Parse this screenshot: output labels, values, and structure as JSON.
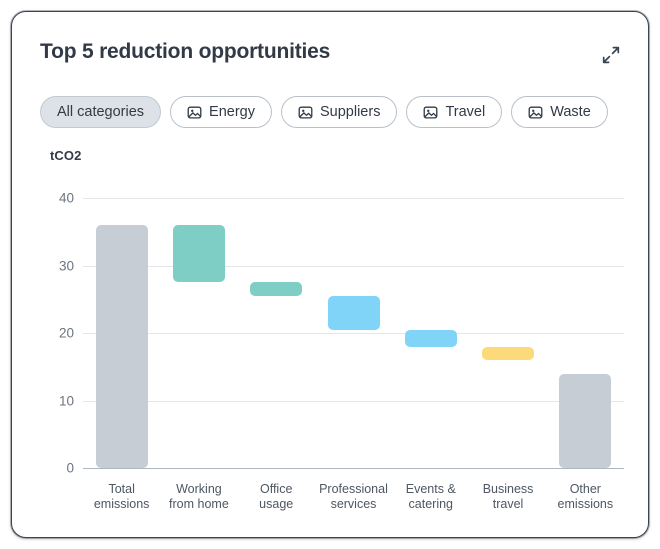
{
  "card": {
    "title": "Top 5 reduction opportunities",
    "expand_icon": "expand-arrows-icon"
  },
  "filters": {
    "chips": [
      {
        "label": "All categories",
        "active": true,
        "icon": null
      },
      {
        "label": "Energy",
        "active": false,
        "icon": "image-placeholder-icon"
      },
      {
        "label": "Suppliers",
        "active": false,
        "icon": "image-placeholder-icon"
      },
      {
        "label": "Travel",
        "active": false,
        "icon": "image-placeholder-icon"
      },
      {
        "label": "Waste",
        "active": false,
        "icon": "image-placeholder-icon"
      }
    ]
  },
  "colors": {
    "gray": "#c6cdd4",
    "teal": "#7ecec6",
    "blue": "#80d4f8",
    "yellow": "#fcd979",
    "grid": "#e3e7eb",
    "axis": "#aeb6bf",
    "text": "#313a46",
    "chip_active_bg": "#dde2e8"
  },
  "chart_data": {
    "type": "bar",
    "subtype": "waterfall",
    "title": "Top 5 reduction opportunities",
    "xlabel": "",
    "ylabel": "tCO2",
    "ylim": [
      0,
      40
    ],
    "yticks": [
      0,
      10,
      20,
      30,
      40
    ],
    "ytick_labels": [
      "0",
      "10",
      "20",
      "30",
      "40"
    ],
    "grid": true,
    "legend": false,
    "categories": [
      "Total emissions",
      "Working from home",
      "Office usage",
      "Professional services",
      "Events & catering",
      "Business travel",
      "Other emissions"
    ],
    "bars": [
      {
        "category": "Total emissions",
        "label_line1": "Total",
        "label_line2": "emissions",
        "base": 0,
        "top": 36,
        "value": 36,
        "kind": "total",
        "color": "#c6cdd4"
      },
      {
        "category": "Working from home",
        "label_line1": "Working",
        "label_line2": "from home",
        "base": 27.5,
        "top": 36,
        "value": -8.5,
        "kind": "decrease",
        "color": "#7ecec6"
      },
      {
        "category": "Office usage",
        "label_line1": "Office",
        "label_line2": "usage",
        "base": 25.5,
        "top": 27.5,
        "value": -2,
        "kind": "decrease",
        "color": "#7ecec6"
      },
      {
        "category": "Professional services",
        "label_line1": "Professional",
        "label_line2": "services",
        "base": 20.5,
        "top": 25.5,
        "value": -5,
        "kind": "decrease",
        "color": "#80d4f8"
      },
      {
        "category": "Events & catering",
        "label_line1": "Events &",
        "label_line2": "catering",
        "base": 18,
        "top": 20.5,
        "value": -2.5,
        "kind": "decrease",
        "color": "#80d4f8"
      },
      {
        "category": "Business travel",
        "label_line1": "Business",
        "label_line2": "travel",
        "base": 16,
        "top": 18,
        "value": -2,
        "kind": "decrease",
        "color": "#fcd979"
      },
      {
        "category": "Other emissions",
        "label_line1": "Other",
        "label_line2": "emissions",
        "base": 0,
        "top": 14,
        "value": 14,
        "kind": "total",
        "color": "#c6cdd4"
      }
    ]
  }
}
